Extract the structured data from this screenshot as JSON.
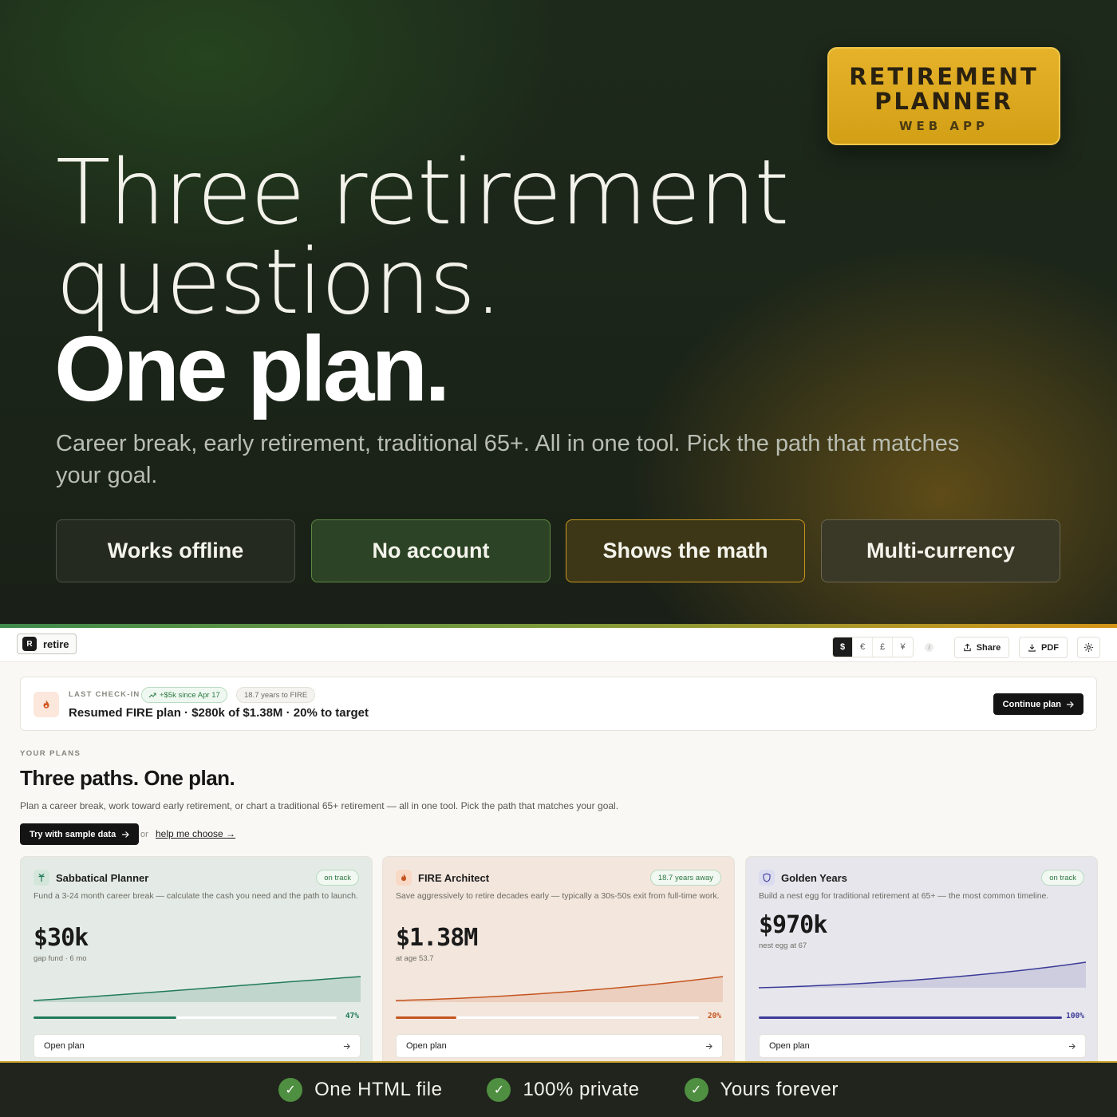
{
  "hero": {
    "badge": {
      "title": "RETIREMENT\nPLANNER",
      "subtitle": "WEB APP"
    },
    "headline_line1": "Three retirement",
    "headline_line2": "questions.",
    "headline_bold": "One plan.",
    "subtitle": "Career break, early retirement, traditional 65+. All in one tool. Pick the path that matches your goal.",
    "pills": [
      "Works offline",
      "No account",
      "Shows the math",
      "Multi-currency"
    ]
  },
  "app": {
    "brand": {
      "mark": "R",
      "name": "retire"
    },
    "currencies": [
      {
        "symbol": "$",
        "active": true
      },
      {
        "symbol": "€",
        "active": false
      },
      {
        "symbol": "£",
        "active": false
      },
      {
        "symbol": "¥",
        "active": false
      }
    ],
    "info_glyph": "i",
    "share_label": "Share",
    "pdf_label": "PDF",
    "checkin": {
      "label": "LAST CHECK-IN",
      "tag_gain": "+$5k since Apr 17",
      "tag_years": "18.7 years to FIRE",
      "title": "Resumed FIRE plan · $280k of $1.38M · 20% to target",
      "continue_label": "Continue plan"
    },
    "plans": {
      "label": "YOUR PLANS",
      "title": "Three paths. One plan.",
      "description": "Plan a career break, work toward early retirement, or chart a traditional 65+ retirement — all in one tool. Pick the path that matches your goal.",
      "sample_button": "Try with sample data",
      "or": "or",
      "help_link": "help me choose →"
    },
    "cards": [
      {
        "name": "Sabbatical Planner",
        "status": "on track",
        "description": "Fund a 3-24 month career break — calculate the cash you need and the path to launch.",
        "value": "$30k",
        "caption": "gap fund · 6 mo",
        "progress": 47,
        "progress_label": "47%",
        "open_label": "Open plan",
        "color": "#1f7a5a",
        "icon": "sprout-icon"
      },
      {
        "name": "FIRE Architect",
        "status": "18.7 years away",
        "description": "Save aggressively to retire decades early — typically a 30s-50s exit from full-time work.",
        "value": "$1.38M",
        "caption": "at age 53.7",
        "progress": 20,
        "progress_label": "20%",
        "open_label": "Open plan",
        "color": "#c4541e",
        "icon": "flame-icon"
      },
      {
        "name": "Golden Years",
        "status": "on track",
        "description": "Build a nest egg for traditional retirement at 65+ — the most common timeline.",
        "value": "$970k",
        "caption": "nest egg at 67",
        "progress": 100,
        "progress_label": "100%",
        "open_label": "Open plan",
        "color": "#3b3a98",
        "icon": "shield-icon"
      }
    ]
  },
  "footer": {
    "items": [
      "One HTML file",
      "100% private",
      "Yours forever"
    ],
    "check_glyph": "✓"
  }
}
